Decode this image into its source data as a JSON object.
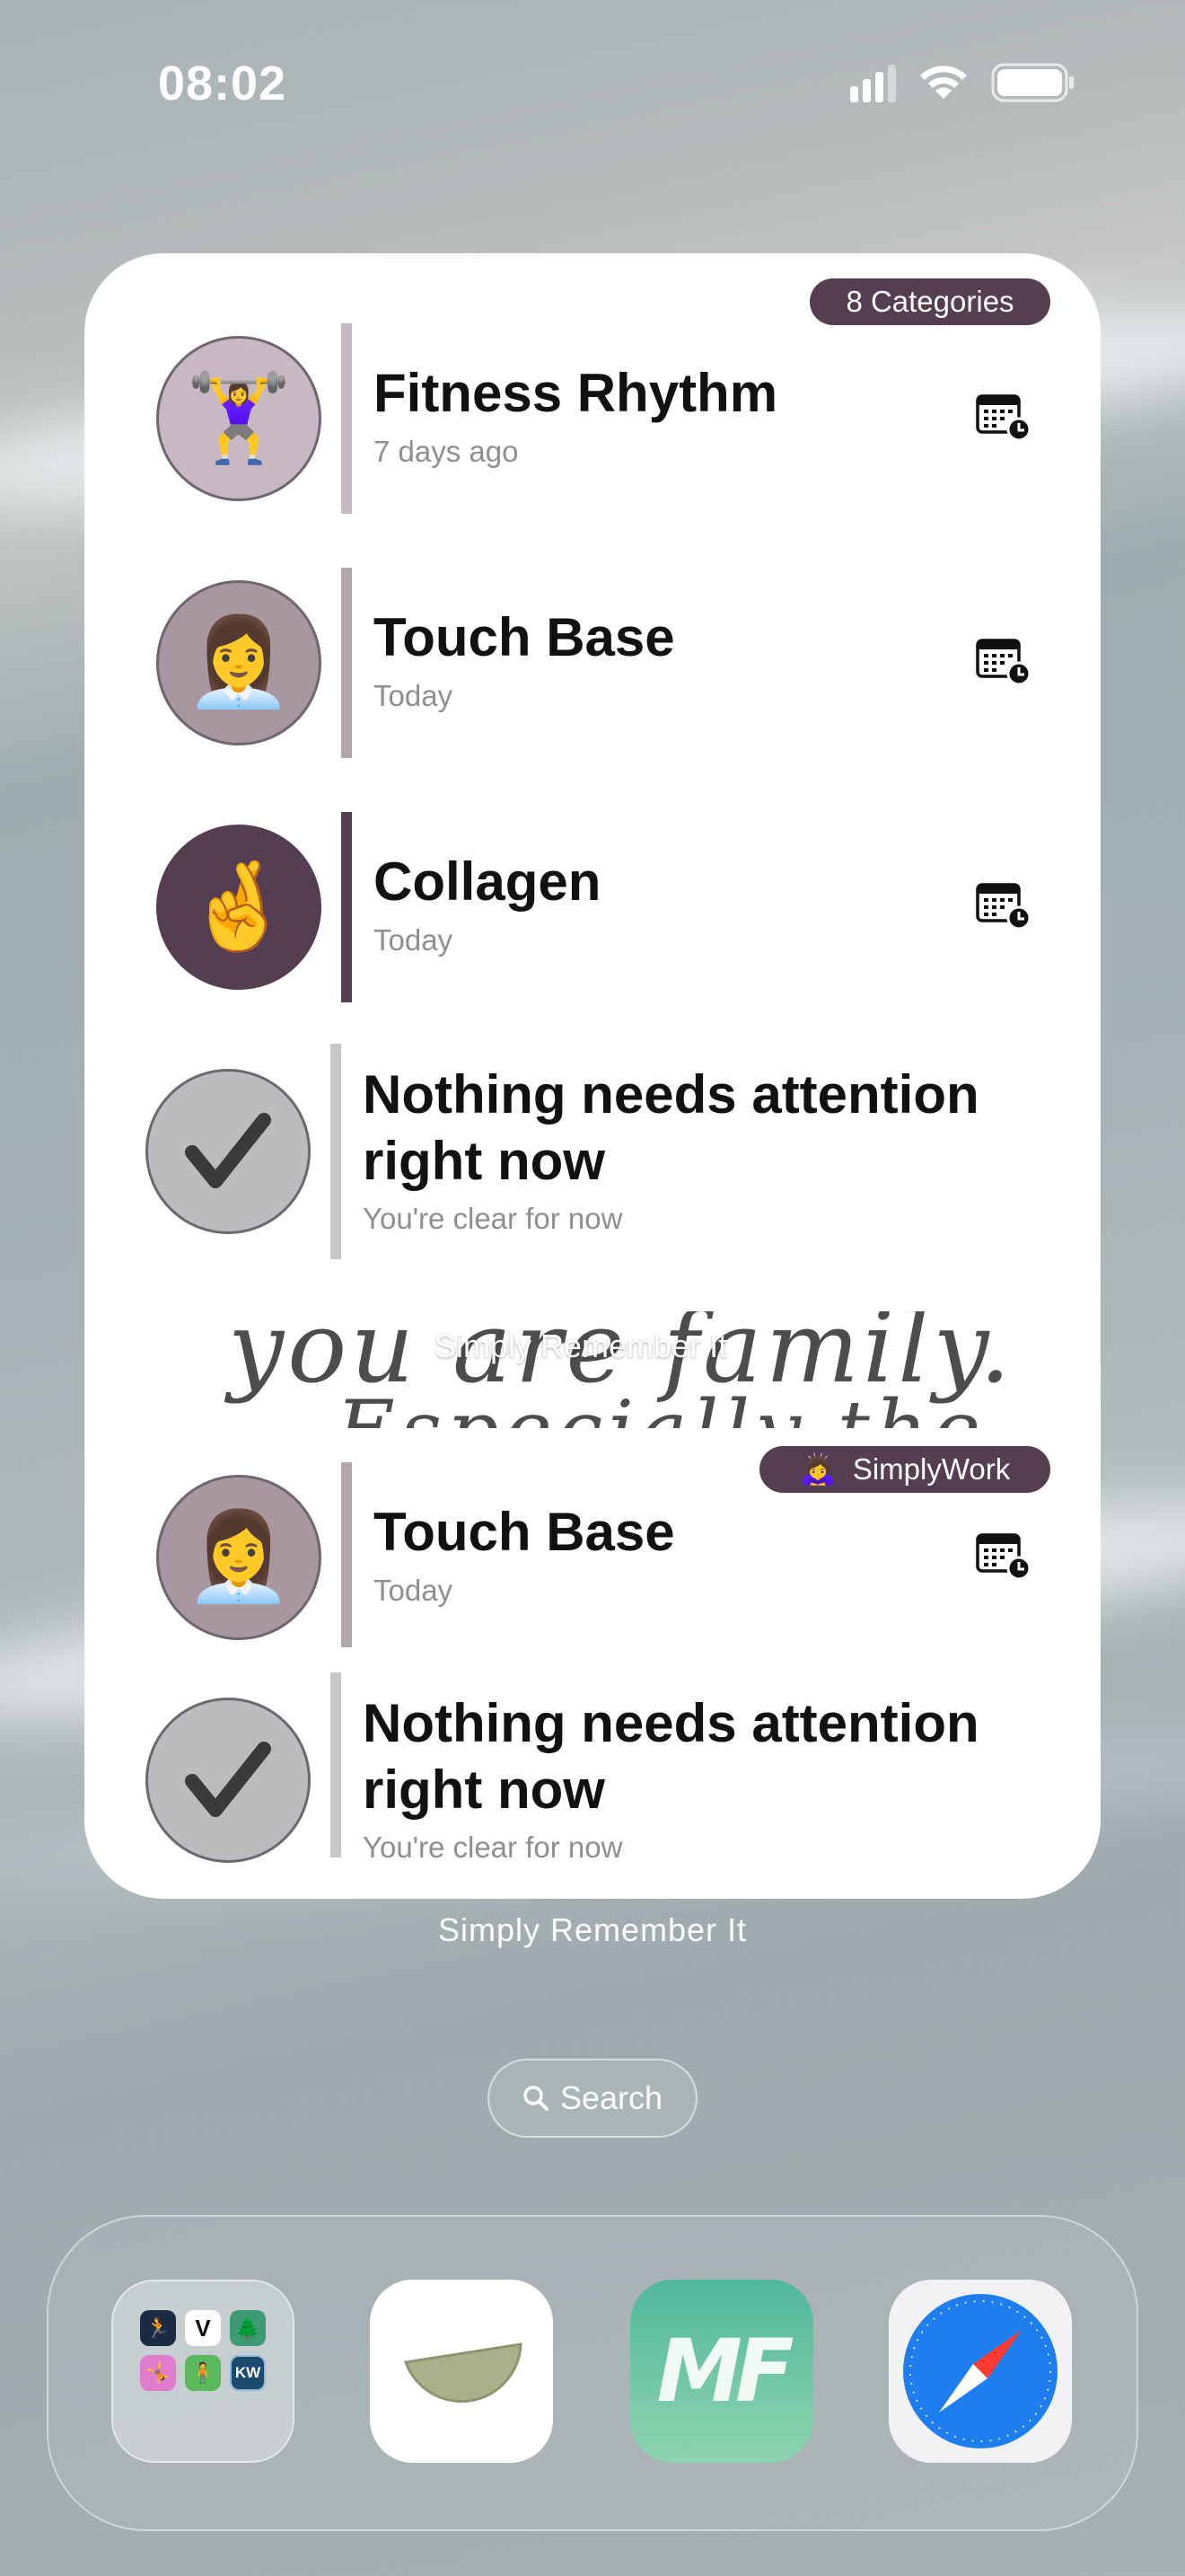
{
  "status_bar": {
    "time": "08:02"
  },
  "widget": {
    "badge_label": "8 Categories",
    "items": [
      {
        "emoji": "🏋️‍♀️",
        "title": "Fitness Rhythm",
        "subtitle": "7 days ago",
        "avatar_color": "#c8b8c4",
        "bar_color": "#c8b8c4"
      },
      {
        "emoji": "👩‍💼",
        "title": "Touch Base",
        "subtitle": "Today",
        "avatar_color": "#a8979f",
        "bar_color": "#b4a5ae"
      },
      {
        "emoji": "🤞",
        "title": "Collagen",
        "subtitle": "Today",
        "avatar_color": "#553e52",
        "bar_color": "#553e52"
      }
    ],
    "empty_state": {
      "title": "Nothing needs attention right now",
      "subtitle": "You're clear for now"
    },
    "background_script_text": "you are family.",
    "background_script_text2": "Especially the"
  },
  "widget_overlay_label": "Simply Remember It",
  "widget2": {
    "badge_emoji": "🙇‍♀️",
    "badge_label": "SimplyWork",
    "items": [
      {
        "emoji": "👩‍💼",
        "title": "Touch Base",
        "subtitle": "Today",
        "avatar_color": "#a8979f",
        "bar_color": "#b4a5ae"
      }
    ],
    "empty_state": {
      "title": "Nothing needs attention right now",
      "subtitle": "You're clear for now"
    }
  },
  "app_label": "Simply Remember It",
  "search": {
    "label": "Search"
  },
  "colors": {
    "accent": "#553e52",
    "check_circle": "#bcbcbe"
  },
  "dock": {
    "apps": [
      {
        "name": "folder-apps",
        "mini_icons": [
          "🏃",
          "V",
          "🌲",
          "🤸",
          "🧍",
          "KW"
        ]
      },
      {
        "name": "lime-app-icon"
      },
      {
        "name": "mf-app-icon",
        "label": "MF"
      },
      {
        "name": "safari-icon"
      }
    ]
  }
}
